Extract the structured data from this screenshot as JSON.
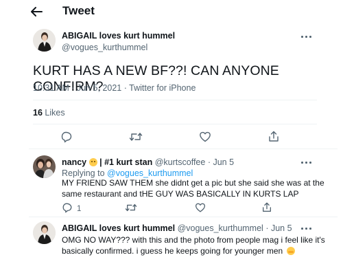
{
  "header": {
    "title": "Tweet"
  },
  "main_tweet": {
    "author_name": "ABIGAIL loves kurt hummel",
    "author_handle": "@vogues_kurthummel",
    "text": "KURT HAS A NEW BF??! CAN ANYONE CONFIRM?",
    "meta": "10:31 AM · Jun 5, 2021 · Twitter for iPhone",
    "likes_count": "16",
    "likes_label": "Likes"
  },
  "replies": [
    {
      "author_name": "nancy",
      "author_suffix": "| #1 kurt stan",
      "author_handle": "@kurtscoffee",
      "separator": "·",
      "time": "Jun 5",
      "replying_prefix": "Replying to",
      "replying_to": "@vogues_kurthummel",
      "text": "MY FRIEND SAW THEM she didnt get a pic but she said she was at the same restaurant and tHE GUY WAS BASICALLY IN KURTS LAP",
      "reply_count": "1"
    },
    {
      "author_name": "ABIGAIL loves kurt hummel",
      "author_handle": "@vogues_kurthummel",
      "separator": "·",
      "time": "Jun 5",
      "text": "OMG NO WAY??? with this and the photo from people mag i feel like it's basically confirmed. i guess he keeps going for younger men"
    }
  ],
  "icons": {
    "back": "arrow-left-icon",
    "more": "more-dots-icon",
    "reply": "reply-icon",
    "retweet": "retweet-icon",
    "like": "heart-icon",
    "share": "share-icon"
  },
  "colors": {
    "link": "#1d9bf0",
    "secondary": "#536471",
    "divider": "#eff3f4"
  }
}
